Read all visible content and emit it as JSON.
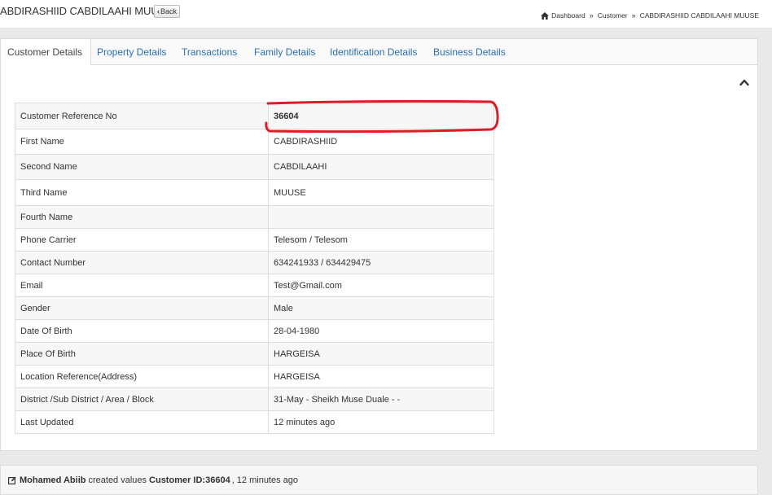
{
  "header": {
    "title": "ABDIRASHIID CABDILAAHI MUUSE",
    "back_label": "Back",
    "breadcrumb": [
      "Dashboard",
      "Customer",
      "CABDIRASHIID CABDILAAHI MUUSE"
    ]
  },
  "tabs": [
    {
      "label": "Customer Details",
      "active": true
    },
    {
      "label": "Property Details",
      "active": false
    },
    {
      "label": "Transactions",
      "active": false
    },
    {
      "label": "Family Details",
      "active": false
    },
    {
      "label": "Identification Details",
      "active": false
    },
    {
      "label": "Business Details",
      "active": false
    }
  ],
  "details": [
    {
      "label": "Customer Reference No",
      "value": "36604"
    },
    {
      "label": "First Name",
      "value": "CABDIRASHIID"
    },
    {
      "label": "Second Name",
      "value": "CABDILAAHI"
    },
    {
      "label": "Third Name",
      "value": "MUUSE"
    },
    {
      "label": "Fourth Name",
      "value": ""
    },
    {
      "label": "Phone Carrier",
      "value": "Telesom / Telesom"
    },
    {
      "label": "Contact Number",
      "value": "634241933 / 634429475"
    },
    {
      "label": "Email",
      "value": "Test@Gmail.com"
    },
    {
      "label": "Gender",
      "value": "Male"
    },
    {
      "label": "Date Of Birth",
      "value": "28-04-1980"
    },
    {
      "label": "Place Of Birth",
      "value": "HARGEISA"
    },
    {
      "label": "Location Reference(Address)",
      "value": "HARGEISA"
    },
    {
      "label": "District /Sub District / Area / Block",
      "value": "31-May - Sheikh Muse Duale - -"
    },
    {
      "label": "Last Updated",
      "value": "12 minutes ago"
    }
  ],
  "activity": {
    "user": "Mohamed Abiib",
    "action": "created values",
    "target": "Customer ID:36604",
    "time": ", 12 minutes ago"
  },
  "colors": {
    "link": "#2a6fb1",
    "highlight_annotation": "#e01b24",
    "border": "#dddddd"
  },
  "icons": {
    "breadcrumb_home": "home-icon",
    "collapse": "chevron-up-icon",
    "activity": "edit-icon"
  }
}
